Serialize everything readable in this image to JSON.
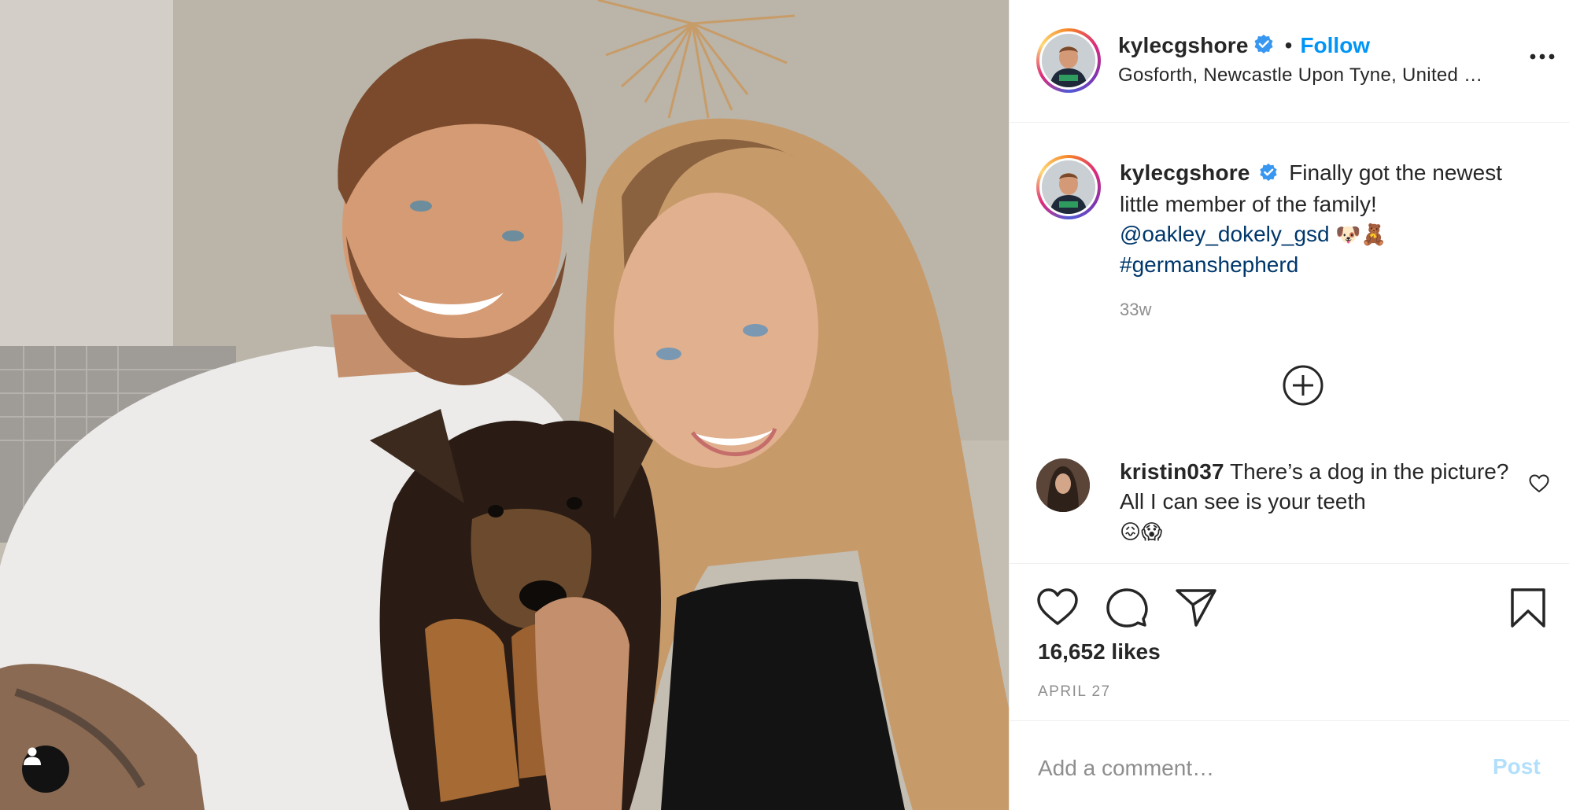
{
  "post": {
    "author": {
      "username": "kylecgshore",
      "verified": true,
      "location": "Gosforth, Newcastle Upon Tyne, United …"
    },
    "follow_label": "Follow",
    "header_separator": "•",
    "caption": {
      "username": "kylecgshore",
      "text": "Finally got the newest little member of the family!",
      "mention": "@oakley_dokely_gsd",
      "emoji": "🐶🧸",
      "hashtag": "#germanshepherd"
    },
    "time_ago": "33w",
    "comments": [
      {
        "username": "kristin037",
        "text": "There’s a dog in the picture? All I can see is your teeth",
        "emoji": "😖😱"
      }
    ],
    "likes": "16,652 likes",
    "date": "APRIL 27",
    "add_comment": {
      "placeholder": "Add a comment…",
      "post_label": "Post"
    }
  },
  "colors": {
    "link_blue": "#0095f6",
    "mention_blue": "#00376b",
    "verified_blue": "#3897f0",
    "secondary_text": "#8e8e8e",
    "post_disabled": "#b2dffc"
  },
  "icons": {
    "tag_button": "user-tag-icon",
    "more": "more-options-icon",
    "load_more": "plus-circle-icon",
    "like_comment": "heart-icon",
    "like": "heart-icon",
    "comment": "comment-icon",
    "share": "share-icon",
    "save": "bookmark-icon"
  }
}
